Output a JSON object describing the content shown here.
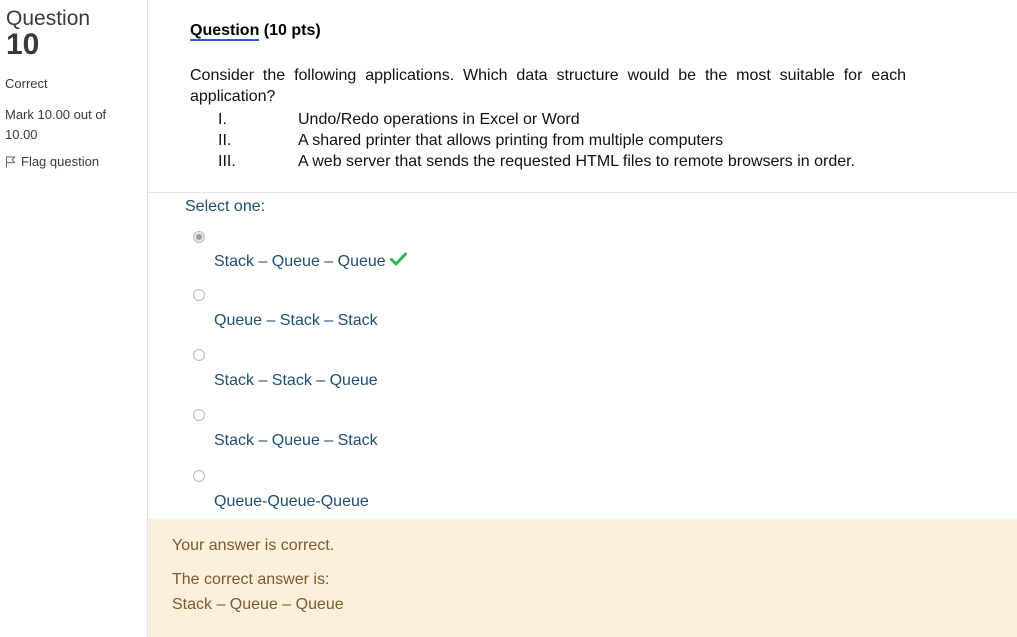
{
  "sidebar": {
    "question_word": "Question",
    "question_number": "10",
    "state": "Correct",
    "grade": "Mark 10.00 out of 10.00",
    "flag_label": "Flag question"
  },
  "question": {
    "header_underlined": "Question",
    "header_rest": " (10 pts)",
    "text": "Consider the following applications. Which data structure would be the most suitable for each application?",
    "items": [
      {
        "num": "I.",
        "text": "Undo/Redo operations in Excel or Word"
      },
      {
        "num": "II.",
        "text": "A shared printer that allows printing from multiple computers"
      },
      {
        "num": "III.",
        "text": "A web server that sends the requested HTML files to remote browsers in order."
      }
    ]
  },
  "answer": {
    "prompt": "Select one:",
    "options": [
      {
        "label": "Stack – Queue – Queue",
        "selected": true,
        "correct": true
      },
      {
        "label": "Queue – Stack – Stack",
        "selected": false
      },
      {
        "label": "Stack – Stack – Queue",
        "selected": false
      },
      {
        "label": "Stack – Queue – Stack",
        "selected": false
      },
      {
        "label": "Queue-Queue-Queue",
        "selected": false
      }
    ]
  },
  "feedback": {
    "status": "Your answer is correct.",
    "correct_intro": "The correct answer is:",
    "correct_answer": "Stack – Queue – Queue"
  },
  "colors": {
    "feedback_bg": "#fcefdc",
    "feedback_text": "#7d5a29",
    "option_text": "#1f4e70",
    "check_green": "#2eb84b"
  }
}
